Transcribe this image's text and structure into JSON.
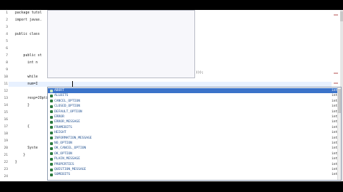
{
  "editor": {
    "line_numbers": [
      "1",
      "2",
      "3",
      "4",
      "5",
      "6",
      "7",
      "8",
      "9",
      "10",
      "11",
      "12",
      "13",
      "14",
      "15",
      "16",
      "17",
      "18",
      "19",
      "20",
      "21",
      "22",
      "23",
      "24"
    ],
    "code_lines": [
      {
        "n": "1",
        "text": "package tutol"
      },
      {
        "n": "2",
        "text": "import javax."
      },
      {
        "n": "3",
        "text": ""
      },
      {
        "n": "4",
        "text": "public class "
      },
      {
        "n": "5",
        "text": ""
      },
      {
        "n": "6",
        "text": ""
      },
      {
        "n": "7",
        "text": "    public st"
      },
      {
        "n": "8",
        "text": "      int n"
      },
      {
        "n": "9",
        "text": ""
      },
      {
        "n": "10",
        "text": "      while"
      },
      {
        "n": "11",
        "text": "      num=I"
      },
      {
        "n": "12",
        "text": ""
      },
      {
        "n": "13",
        "text": "      resp=JOptionPane."
      },
      {
        "n": "14",
        "text": "      }"
      },
      {
        "n": "15",
        "text": ""
      },
      {
        "n": "16",
        "text": ""
      },
      {
        "n": "17",
        "text": "      {"
      },
      {
        "n": "18",
        "text": ""
      },
      {
        "n": "19",
        "text": ""
      },
      {
        "n": "20",
        "text": "      Syste"
      },
      {
        "n": "21",
        "text": "    }"
      },
      {
        "n": "22",
        "text": "}"
      },
      {
        "n": "23",
        "text": ""
      },
      {
        "n": "24",
        "text": ""
      }
    ],
    "tooltip_tail": ")));"
  },
  "autocomplete": {
    "items": [
      {
        "name": "ABORT",
        "type": "int"
      },
      {
        "name": "ALLBITS",
        "type": "int"
      },
      {
        "name": "CANCEL_OPTION",
        "type": "int"
      },
      {
        "name": "CLOSED_OPTION",
        "type": "int"
      },
      {
        "name": "DEFAULT_OPTION",
        "type": "int"
      },
      {
        "name": "ERROR",
        "type": "int"
      },
      {
        "name": "ERROR_MESSAGE",
        "type": "int"
      },
      {
        "name": "FRAMEBITS",
        "type": "int"
      },
      {
        "name": "HEIGHT",
        "type": "int"
      },
      {
        "name": "INFORMATION_MESSAGE",
        "type": "int"
      },
      {
        "name": "NO_OPTION",
        "type": "int"
      },
      {
        "name": "OK_CANCEL_OPTION",
        "type": "int"
      },
      {
        "name": "OK_OPTION",
        "type": "int"
      },
      {
        "name": "PLAIN_MESSAGE",
        "type": "int"
      },
      {
        "name": "PROPERTIES",
        "type": "int"
      },
      {
        "name": "QUESTION_MESSAGE",
        "type": "int"
      },
      {
        "name": "SOMEBITS",
        "type": "int"
      }
    ],
    "selected_index": 0
  },
  "colors": {
    "background": "#000000",
    "editor_bg": "#ffffff",
    "selection": "#3b73c9",
    "field_icon": "#2b7a3e"
  }
}
